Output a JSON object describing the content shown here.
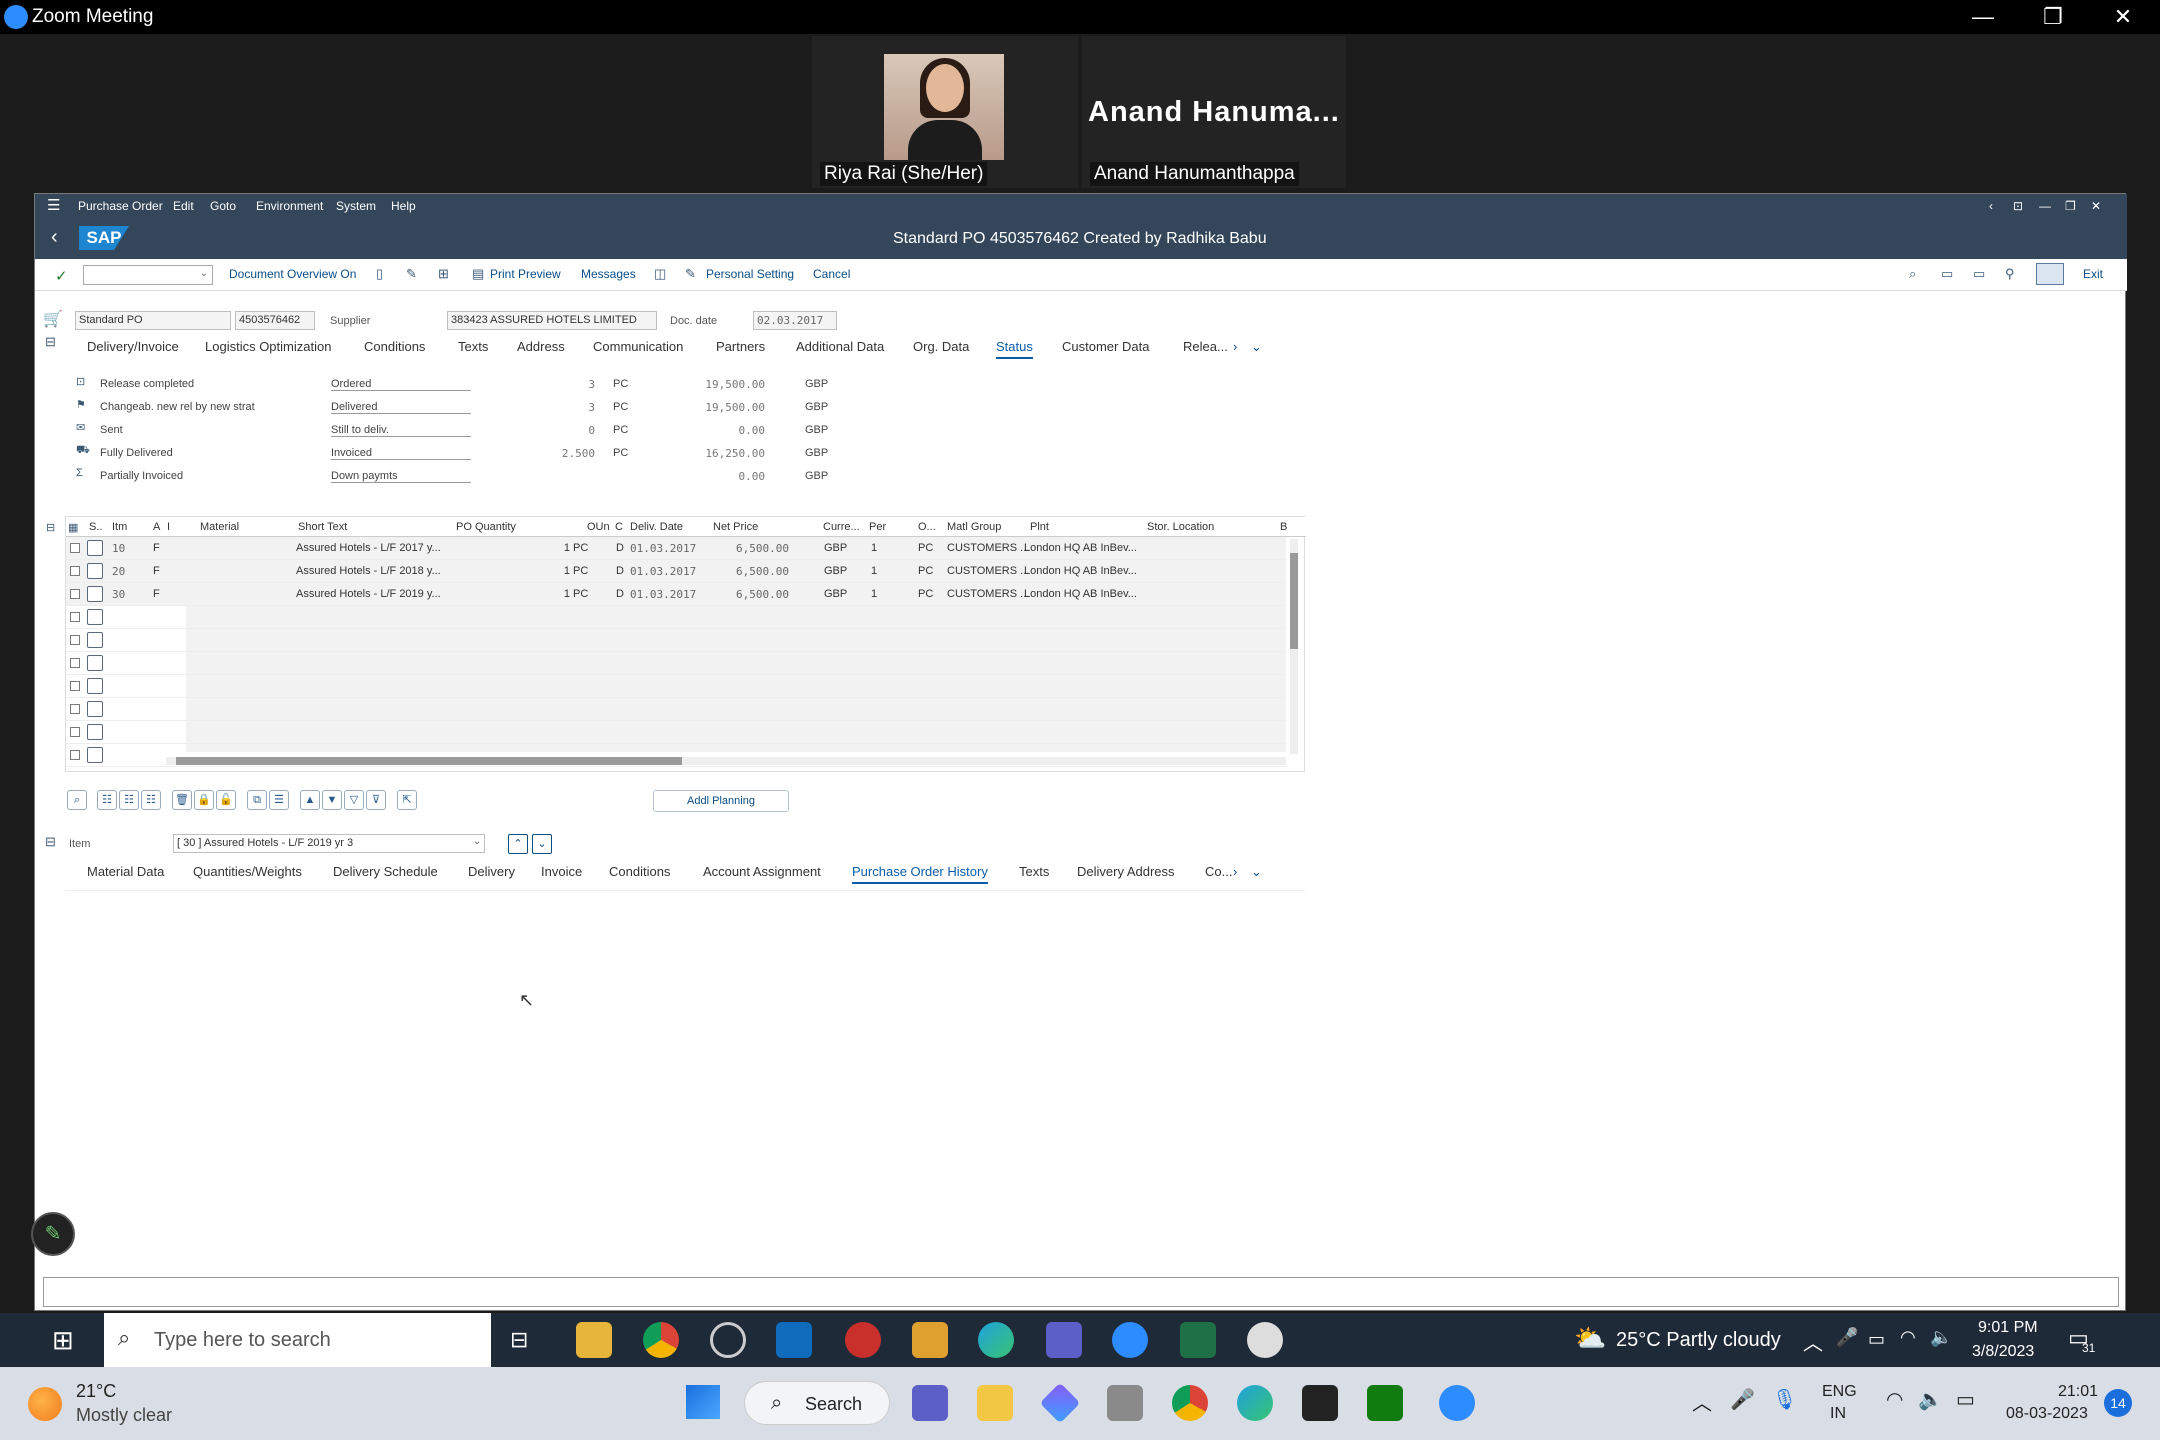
{
  "zoom": {
    "window_title": "Zoom Meeting",
    "participants": [
      {
        "name": "Riya Rai (She/Her)"
      },
      {
        "name": "Anand Hanumanthappa",
        "display": "Anand  Hanuma..."
      }
    ]
  },
  "sap": {
    "menu": [
      "Purchase Order",
      "Edit",
      "Goto",
      "Environment",
      "System",
      "Help"
    ],
    "logo": "SAP",
    "title": "Standard PO 4503576462 Created by Radhika Babu",
    "toolbar": {
      "doc_overview": "Document Overview On",
      "print_preview": "Print Preview",
      "messages": "Messages",
      "personal_setting": "Personal Setting",
      "cancel": "Cancel",
      "exit": "Exit"
    },
    "header": {
      "po_type": "Standard PO",
      "po_number": "4503576462",
      "supplier_label": "Supplier",
      "supplier": "383423 ASSURED HOTELS LIMITED",
      "doc_date_label": "Doc. date",
      "doc_date": "02.03.2017"
    },
    "header_tabs": [
      "Delivery/Invoice",
      "Logistics Optimization",
      "Conditions",
      "Texts",
      "Address",
      "Communication",
      "Partners",
      "Additional Data",
      "Org. Data",
      "Status",
      "Customer Data",
      "Relea..."
    ],
    "header_tab_selected": "Status",
    "status_left": [
      "Release completed",
      "Changeab. new rel by new strat",
      "Sent",
      "Fully Delivered",
      "Partially Invoiced"
    ],
    "status_rows": [
      {
        "label": "Ordered",
        "qty": "3",
        "unit": "PC",
        "value": "19,500.00",
        "cur": "GBP"
      },
      {
        "label": "Delivered",
        "qty": "3",
        "unit": "PC",
        "value": "19,500.00",
        "cur": "GBP"
      },
      {
        "label": "Still to deliv.",
        "qty": "0",
        "unit": "PC",
        "value": "0.00",
        "cur": "GBP"
      },
      {
        "label": "Invoiced",
        "qty": "2.500",
        "unit": "PC",
        "value": "16,250.00",
        "cur": "GBP"
      },
      {
        "label": "Down paymts",
        "qty": "",
        "unit": "",
        "value": "0.00",
        "cur": "GBP"
      }
    ],
    "item_columns": [
      "S..",
      "Itm",
      "A",
      "I",
      "Material",
      "Short Text",
      "PO Quantity",
      "OUn",
      "C",
      "Deliv. Date",
      "Net Price",
      "Curre...",
      "Per",
      "O...",
      "Matl Group",
      "Plnt",
      "Stor. Location",
      "B"
    ],
    "items": [
      {
        "itm": "10",
        "a": "F",
        "short_text": "Assured Hotels - L/F 2017 y...",
        "qty": "1",
        "oun": "PC",
        "c": "D",
        "date": "01.03.2017",
        "price": "6,500.00",
        "cur": "GBP",
        "per": "1",
        "o": "PC",
        "matl": "CUSTOMERS ...",
        "plnt": "London HQ AB InBev..."
      },
      {
        "itm": "20",
        "a": "F",
        "short_text": "Assured Hotels - L/F 2018 y...",
        "qty": "1",
        "oun": "PC",
        "c": "D",
        "date": "01.03.2017",
        "price": "6,500.00",
        "cur": "GBP",
        "per": "1",
        "o": "PC",
        "matl": "CUSTOMERS ...",
        "plnt": "London HQ AB InBev..."
      },
      {
        "itm": "30",
        "a": "F",
        "short_text": "Assured Hotels - L/F 2019 y...",
        "qty": "1",
        "oun": "PC",
        "c": "D",
        "date": "01.03.2017",
        "price": "6,500.00",
        "cur": "GBP",
        "per": "1",
        "o": "PC",
        "matl": "CUSTOMERS ...",
        "plnt": "London HQ AB InBev..."
      }
    ],
    "addl_planning": "Addl Planning",
    "item_label": "Item",
    "item_select": "[ 30 ] Assured Hotels - L/F 2019 yr 3",
    "item_tabs": [
      "Material Data",
      "Quantities/Weights",
      "Delivery Schedule",
      "Delivery",
      "Invoice",
      "Conditions",
      "Account Assignment",
      "Purchase Order History",
      "Texts",
      "Delivery Address",
      "Co..."
    ],
    "item_tab_selected": "Purchase Order History"
  },
  "taskbar_top": {
    "search_placeholder": "Type here to search",
    "weather": "25°C  Partly cloudy",
    "time": "9:01 PM",
    "date": "3/8/2023",
    "notif": "31"
  },
  "taskbar_bottom": {
    "weather_temp": "21°C",
    "weather_desc": "Mostly clear",
    "search": "Search",
    "lang1": "ENG",
    "lang2": "IN",
    "time": "21:01",
    "date": "08-03-2023",
    "notif": "14"
  }
}
